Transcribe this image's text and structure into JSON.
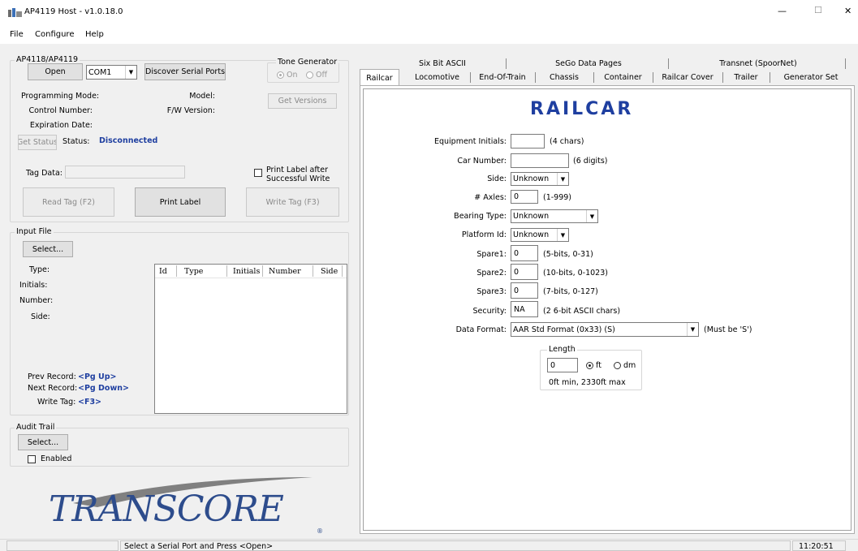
{
  "window": {
    "title": "AP4119 Host - v1.0.18.0",
    "minimize": "—",
    "maximize": "☐",
    "close": "✕"
  },
  "menu": {
    "file": "File",
    "configure": "Configure",
    "help": "Help"
  },
  "reader": {
    "group_title": "AP4118/AP4119",
    "open_label": "Open",
    "port_value": "COM1",
    "discover_label": "Discover Serial Ports",
    "tone": {
      "title": "Tone Generator",
      "on": "On",
      "off": "Off"
    },
    "programming_mode_label": "Programming Mode:",
    "model_label": "Model:",
    "control_number_label": "Control Number:",
    "fw_version_label": "F/W Version:",
    "get_versions_label": "Get Versions",
    "expiration_label": "Expiration Date:",
    "get_status_label": "Get Status",
    "status_label": "Status:",
    "status_value": "Disconnected",
    "tag_data_label": "Tag Data:",
    "tag_data_value": "",
    "print_after_label_1": "Print Label after",
    "print_after_label_2": "Successful Write",
    "read_tag_label": "Read Tag (F2)",
    "print_label_label": "Print Label",
    "write_tag_label": "Write Tag (F3)"
  },
  "input_file": {
    "title": "Input File",
    "select_label": "Select...",
    "type_label": "Type:",
    "initials_label": "Initials:",
    "number_label": "Number:",
    "side_label": "Side:",
    "columns": [
      "Id",
      "Type",
      "Initials",
      "Number",
      "Side"
    ],
    "prev_label": "Prev Record:",
    "prev_key": "<Pg Up>",
    "next_label": "Next Record:",
    "next_key": "<Pg Down>",
    "write_label": "Write Tag:",
    "write_key": "<F3>"
  },
  "audit": {
    "title": "Audit Trail",
    "select_label": "Select...",
    "enabled_label": "Enabled"
  },
  "logo": {
    "text": "TRANSCORE",
    "reg": "®"
  },
  "tabs": {
    "row_top": [
      "Six Bit ASCII",
      "SeGo Data Pages",
      "Transnet (SpoorNet)"
    ],
    "row_bottom": [
      "Railcar",
      "Locomotive",
      "End-Of-Train",
      "Chassis",
      "Container",
      "Railcar Cover",
      "Trailer",
      "Generator Set"
    ],
    "active": "Railcar"
  },
  "railcar": {
    "heading": "RAILCAR",
    "equipment_initials_label": "Equipment Initials:",
    "equipment_initials_value": "",
    "equipment_initials_hint": "(4 chars)",
    "car_number_label": "Car Number:",
    "car_number_value": "",
    "car_number_hint": "(6 digits)",
    "side_label": "Side:",
    "side_value": "Unknown",
    "axles_label": "# Axles:",
    "axles_value": "0",
    "axles_hint": "(1-999)",
    "bearing_label": "Bearing Type:",
    "bearing_value": "Unknown",
    "platform_label": "Platform Id:",
    "platform_value": "Unknown",
    "spare1_label": "Spare1:",
    "spare1_value": "0",
    "spare1_hint": "(5-bits, 0-31)",
    "spare2_label": "Spare2:",
    "spare2_value": "0",
    "spare2_hint": "(10-bits, 0-1023)",
    "spare3_label": "Spare3:",
    "spare3_value": "0",
    "spare3_hint": "(7-bits, 0-127)",
    "security_label": "Security:",
    "security_value": "NA",
    "security_hint": "(2 6-bit ASCII chars)",
    "data_format_label": "Data Format:",
    "data_format_value": "AAR Std Format (0x33) (S)",
    "data_format_hint": "(Must be 'S')",
    "length": {
      "title": "Length",
      "value": "0",
      "ft": "ft",
      "dm": "dm",
      "range": "0ft min, 2330ft max"
    }
  },
  "statusbar": {
    "message": "Select a Serial Port and Press <Open>",
    "time": "11:20:51"
  }
}
